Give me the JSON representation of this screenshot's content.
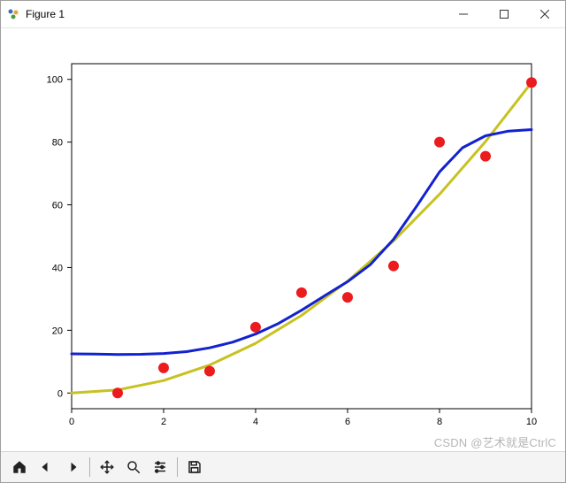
{
  "window": {
    "title": "Figure 1"
  },
  "toolbar": {
    "home": "Home",
    "back": "Back",
    "forward": "Forward",
    "pan": "Pan",
    "zoom": "Zoom",
    "config": "Configure",
    "save": "Save"
  },
  "watermark": "CSDN @艺术就是CtrlC",
  "chart_data": {
    "type": "scatter+line",
    "xlim": [
      0,
      10
    ],
    "ylim": [
      -5,
      105
    ],
    "xticks": [
      0,
      2,
      4,
      6,
      8,
      10
    ],
    "yticks": [
      0,
      20,
      40,
      60,
      80,
      100
    ],
    "scatter": {
      "x": [
        1,
        2,
        3,
        4,
        5,
        6,
        7,
        8,
        9,
        10
      ],
      "y": [
        0,
        8,
        7,
        21,
        32,
        30.5,
        40.5,
        80,
        75.5,
        99
      ],
      "color": "#ec1b1e"
    },
    "series": [
      {
        "name": "yellow-curve",
        "color": "#c7c220",
        "x": [
          0,
          1,
          2,
          3,
          4,
          5,
          6,
          7,
          8,
          9,
          10
        ],
        "y": [
          0.0,
          0.99,
          3.96,
          8.91,
          15.84,
          24.75,
          35.64,
          48.51,
          63.36,
          80.19,
          99.0
        ]
      },
      {
        "name": "blue-curve",
        "color": "#1222d0",
        "x": [
          0.0,
          0.5,
          1.0,
          1.5,
          2.0,
          2.5,
          3.0,
          3.5,
          4.0,
          4.5,
          5.0,
          5.5,
          6.0,
          6.5,
          7.0,
          7.5,
          8.0,
          8.5,
          9.0,
          9.5,
          10.0
        ],
        "y": [
          12.5,
          12.4,
          12.3,
          12.35,
          12.6,
          13.2,
          14.4,
          16.2,
          18.8,
          22.2,
          26.4,
          31.0,
          35.5,
          41.0,
          49.0,
          59.5,
          70.5,
          78.2,
          82.0,
          83.5,
          84.0
        ]
      }
    ]
  }
}
